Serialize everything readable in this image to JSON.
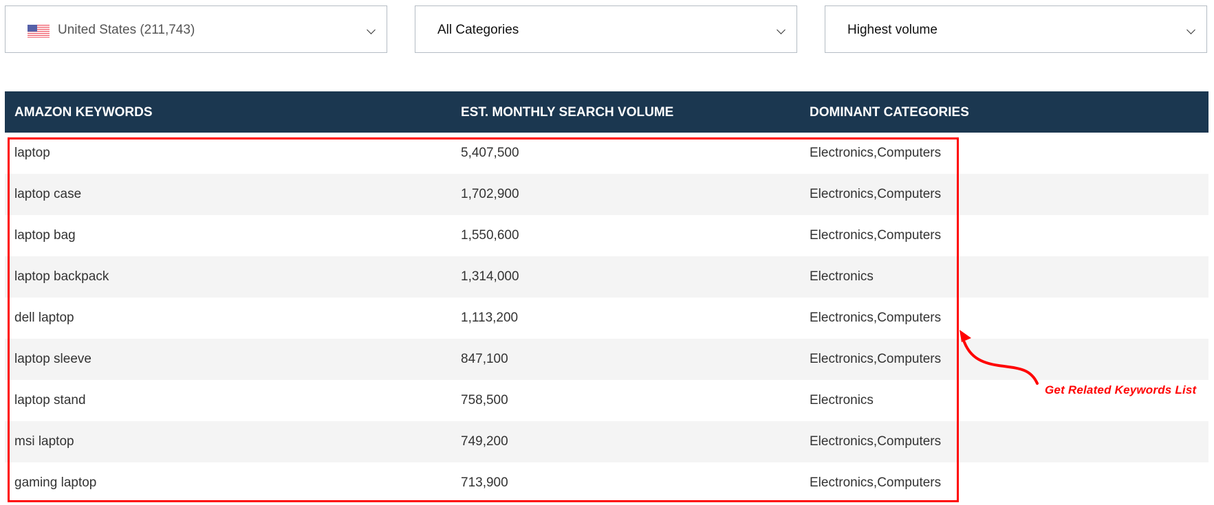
{
  "filters": {
    "country": {
      "label": "United States (211,743)",
      "icon": "us-flag-icon"
    },
    "category": {
      "label": "All Categories"
    },
    "sort": {
      "label": "Highest volume"
    }
  },
  "table": {
    "headers": [
      "AMAZON KEYWORDS",
      "EST. MONTHLY SEARCH VOLUME",
      "DOMINANT CATEGORIES"
    ],
    "rows": [
      [
        "laptop",
        "5,407,500",
        "Electronics,Computers"
      ],
      [
        "laptop case",
        "1,702,900",
        "Electronics,Computers"
      ],
      [
        "laptop bag",
        "1,550,600",
        "Electronics,Computers"
      ],
      [
        "laptop backpack",
        "1,314,000",
        "Electronics"
      ],
      [
        "dell laptop",
        "1,113,200",
        "Electronics,Computers"
      ],
      [
        "laptop sleeve",
        "847,100",
        "Electronics,Computers"
      ],
      [
        "laptop stand",
        "758,500",
        "Electronics"
      ],
      [
        "msi laptop",
        "749,200",
        "Electronics,Computers"
      ],
      [
        "gaming laptop",
        "713,900",
        "Electronics,Computers"
      ]
    ]
  },
  "annotation": {
    "text": "Get Related Keywords List",
    "color": "#ff0000"
  },
  "colors": {
    "header_bg": "#1b3750",
    "stripe": "#f4f4f4"
  }
}
